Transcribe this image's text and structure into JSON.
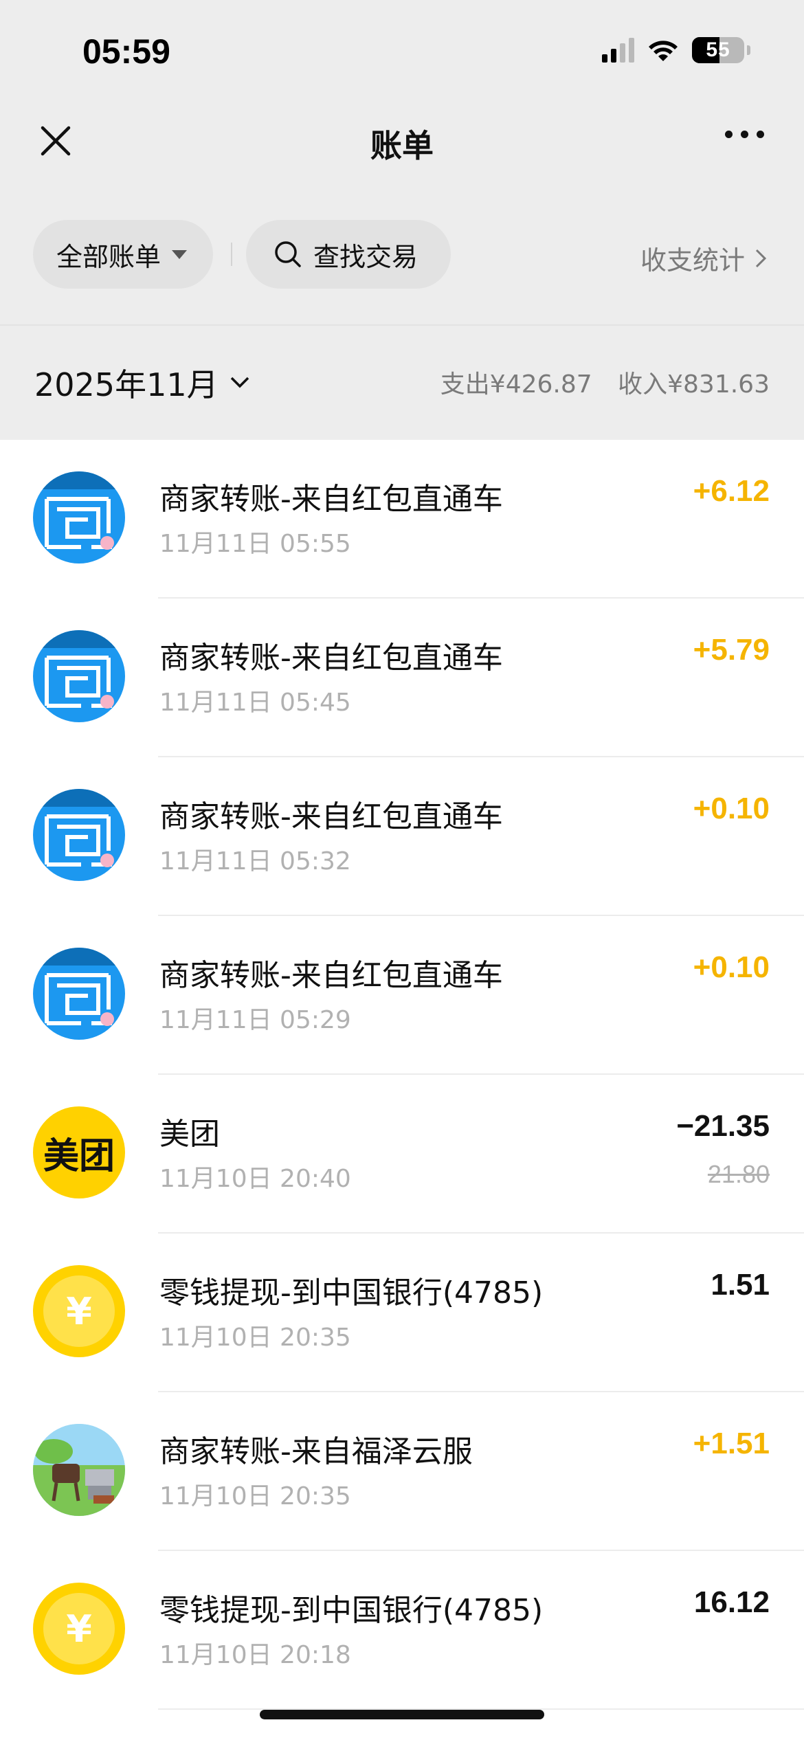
{
  "status_bar": {
    "time": "05:59",
    "battery": "55"
  },
  "nav": {
    "title": "账单",
    "close_icon": "close-icon",
    "more_icon": "more-icon"
  },
  "filters": {
    "all_bills": "全部账单",
    "search": "查找交易",
    "stats": "收支统计"
  },
  "month": {
    "label": "2025年11月",
    "expense": "支出¥426.87",
    "income": "收入¥831.63"
  },
  "colors": {
    "income_amount": "#f5b400",
    "background_gray": "#ededed",
    "meituan_yellow": "#ffd100",
    "maze_blue": "#1c98f0"
  },
  "transactions": [
    {
      "avatar": "maze-avatar",
      "title": "商家转账-来自红包直通车",
      "time": "11月11日 05:55",
      "amount": "+6.12",
      "type": "income"
    },
    {
      "avatar": "maze-avatar",
      "title": "商家转账-来自红包直通车",
      "time": "11月11日 05:45",
      "amount": "+5.79",
      "type": "income"
    },
    {
      "avatar": "maze-avatar",
      "title": "商家转账-来自红包直通车",
      "time": "11月11日 05:32",
      "amount": "+0.10",
      "type": "income"
    },
    {
      "avatar": "maze-avatar",
      "title": "商家转账-来自红包直通车",
      "time": "11月11日 05:29",
      "amount": "+0.10",
      "type": "income"
    },
    {
      "avatar": "meituan-logo",
      "avatar_text": "美团",
      "title": "美团",
      "time": "11月10日 20:40",
      "amount": "−21.35",
      "original": "21.80",
      "type": "expense"
    },
    {
      "avatar": "coin-icon",
      "avatar_text": "¥",
      "title": "零钱提现-到中国银行(4785)",
      "time": "11月10日 20:35",
      "amount": "1.51",
      "type": "neutral"
    },
    {
      "avatar": "bbq-avatar",
      "title": "商家转账-来自福泽云服",
      "time": "11月10日 20:35",
      "amount": "+1.51",
      "type": "income"
    },
    {
      "avatar": "coin-icon",
      "avatar_text": "¥",
      "title": "零钱提现-到中国银行(4785)",
      "time": "11月10日 20:18",
      "amount": "16.12",
      "type": "neutral"
    }
  ]
}
